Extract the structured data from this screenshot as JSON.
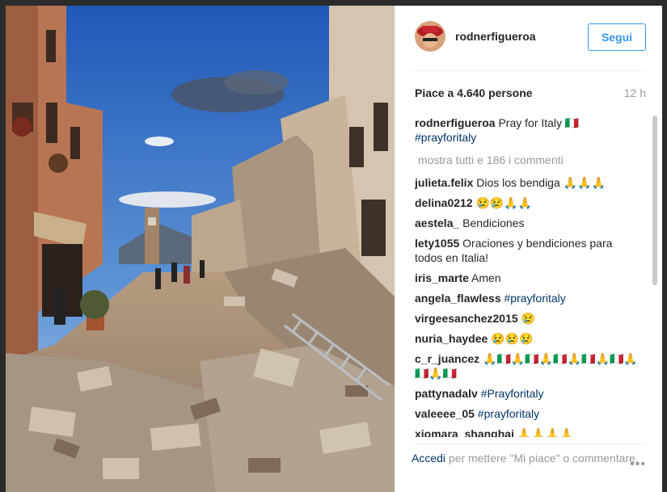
{
  "post": {
    "username": "rodnerfigueroa",
    "follow_label": "Segui",
    "likes": "Piace a 4.640 persone",
    "time": "12 h",
    "caption_user": "rodnerfigueroa",
    "caption_text": " Pray for Italy 🇮🇹",
    "caption_hashtag": "#prayforitaly",
    "show_all_comments": "mostra tutti e 186 i commenti"
  },
  "comments": [
    {
      "user": "julieta.felix",
      "text": " Dios los bendiga 🙏🙏🙏"
    },
    {
      "user": "delina0212",
      "text": " 😢😢🙏🙏"
    },
    {
      "user": "aestela_",
      "text": " Bendiciones"
    },
    {
      "user": "lety1055",
      "text": " Oraciones y bendiciones para todos en Italia!"
    },
    {
      "user": "iris_marte",
      "text": " Amen"
    },
    {
      "user": "angela_flawless",
      "text": " ",
      "hashtag": "#prayforitaly"
    },
    {
      "user": "virgeesanchez2015",
      "text": " 😢"
    },
    {
      "user": "nuria_haydee",
      "text": " 😢😢😢"
    },
    {
      "user": "c_r_juancez",
      "text": " 🙏🇮🇹🙏🇮🇹🙏🇮🇹🙏🇮🇹🙏🇮🇹🙏🇮🇹🙏🇮🇹"
    },
    {
      "user": "pattynadalv",
      "text": " ",
      "hashtag": "#Prayforitaly"
    },
    {
      "user": "valeeee_05",
      "text": " ",
      "hashtag": "#prayforitaly"
    },
    {
      "user": "xiomara_shanghai",
      "text": " 🙏🙏🙏🙏"
    }
  ],
  "footer": {
    "login_label": "Accedi",
    "login_text": " per mettere \"Mi piace\" o commentare.",
    "more_label": "•••"
  },
  "icons": {
    "avatar": "avatar-icon",
    "more": "more-options-icon"
  },
  "colors": {
    "accent": "#3897f0",
    "link": "#003569",
    "muted": "#999999"
  }
}
